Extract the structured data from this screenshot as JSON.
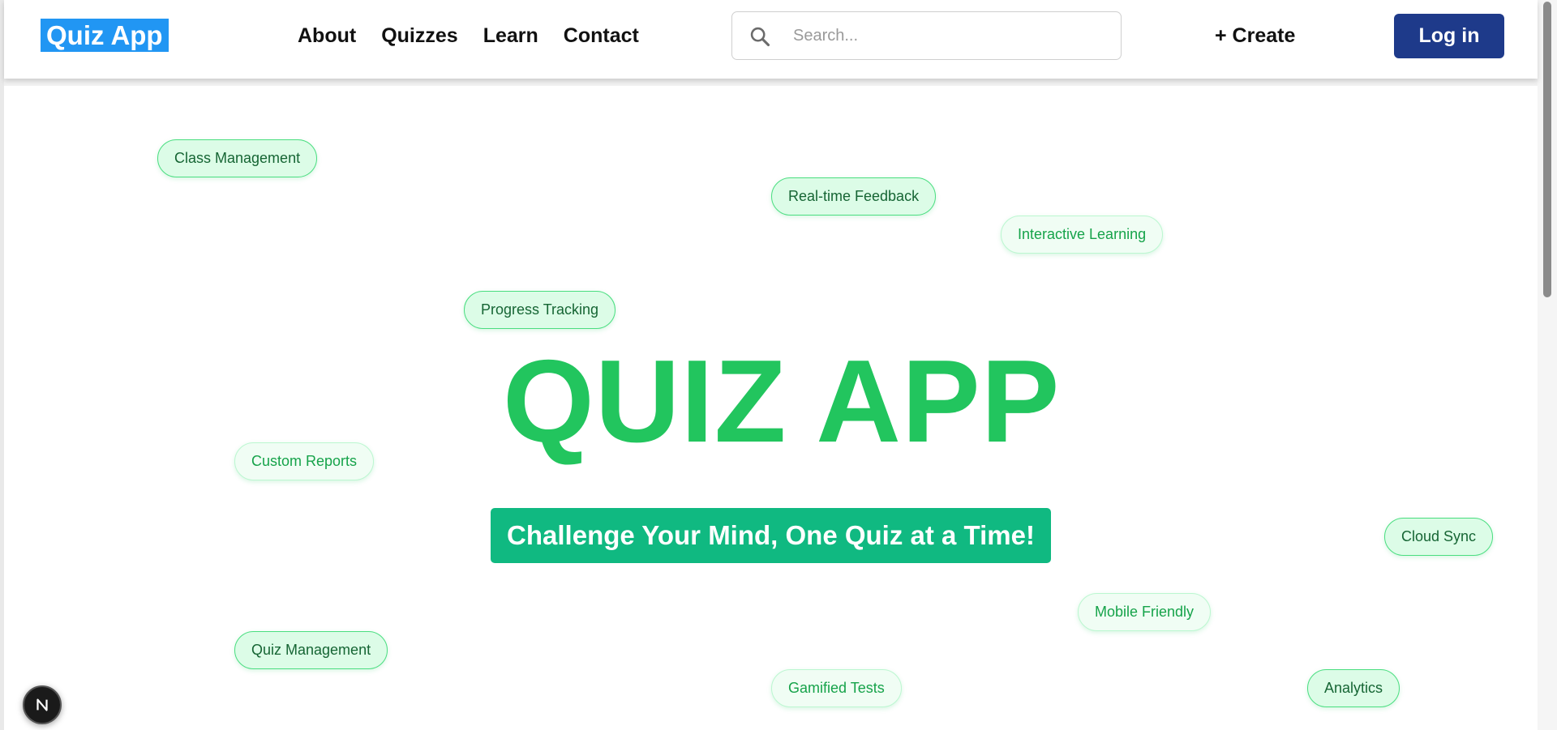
{
  "header": {
    "logo_text": "Quiz App",
    "nav": [
      {
        "label": "About"
      },
      {
        "label": "Quizzes"
      },
      {
        "label": "Learn"
      },
      {
        "label": "Contact"
      }
    ],
    "search": {
      "placeholder": "Search...",
      "value": ""
    },
    "create_label": "+ Create",
    "login_label": "Log in"
  },
  "hero": {
    "title": "QUIZ APP",
    "tagline": "Challenge Your Mind, One Quiz at a Time!"
  },
  "tags": {
    "class_management": "Class Management",
    "realtime_feedback": "Real-time Feedback",
    "interactive_learning": "Interactive Learning",
    "progress_tracking": "Progress Tracking",
    "custom_reports": "Custom Reports",
    "cloud_sync": "Cloud Sync",
    "mobile_friendly": "Mobile Friendly",
    "quiz_management": "Quiz Management",
    "gamified_tests": "Gamified Tests",
    "analytics": "Analytics"
  },
  "colors": {
    "logo_bg": "#2196f3",
    "login_bg": "#1e3a8a",
    "hero_green": "#22c55e",
    "tagline_bg": "#10b981"
  },
  "icons": {
    "search": "search-icon",
    "badge": "nextjs-logo-icon"
  }
}
